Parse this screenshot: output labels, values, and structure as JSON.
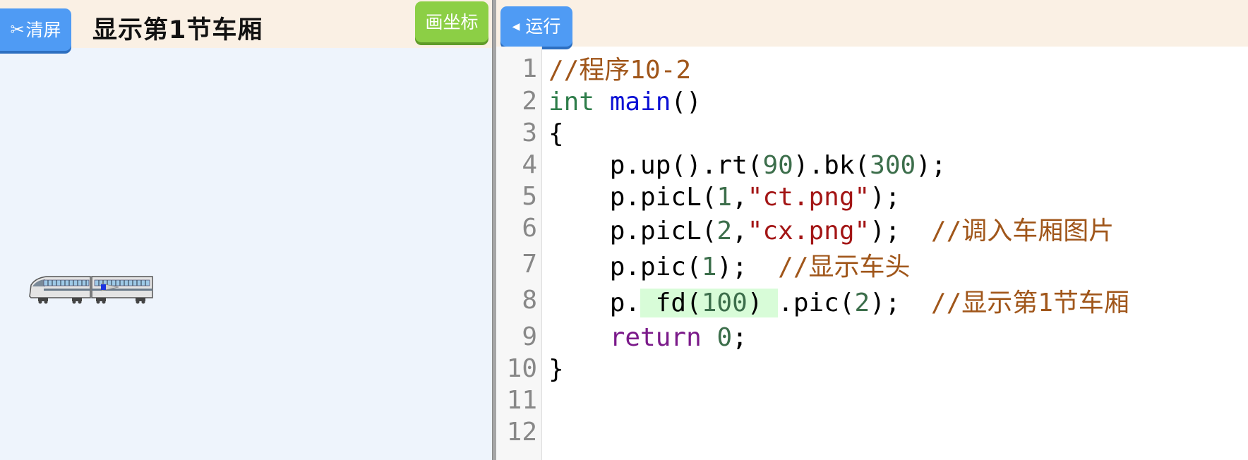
{
  "left": {
    "clear_label": "清屏",
    "title": "显示第1节车厢",
    "grid_label": "画坐标"
  },
  "right": {
    "run_label": "运行"
  },
  "icons": {
    "clear": "scissors-icon",
    "run": "triangle-left-icon"
  },
  "colors": {
    "blue_button": "#4f9bf4",
    "green_button": "#8ccf45",
    "toolbar_bg": "#faf0e4",
    "canvas_bg": "#eef4fc",
    "comment": "#a0561a",
    "keyword": "#2e7d4a",
    "function": "#0b10d4",
    "number": "#3c6e4b",
    "string": "#a31515",
    "return": "#7b1a8a",
    "highlight": "#d8fcd8"
  },
  "code": {
    "line_numbers": [
      "1",
      "2",
      "3",
      "4",
      "5",
      "6",
      "7",
      "8",
      "9",
      "10",
      "11",
      "12"
    ],
    "l1": {
      "comment": "//程序10-2"
    },
    "l2": {
      "kw": "int",
      "fn": "main",
      "rest": "()"
    },
    "l3": {
      "text": "{"
    },
    "l4": {
      "a": "    p.up().rt(",
      "n1": "90",
      "b": ").bk(",
      "n2": "300",
      "c": ");"
    },
    "l5": {
      "a": "    p.picL(",
      "n": "1",
      "b": ",",
      "s": "\"ct.png\"",
      "c": ");"
    },
    "l6": {
      "a": "    p.picL(",
      "n": "2",
      "b": ",",
      "s": "\"cx.png\"",
      "c": ");  ",
      "comment": "//调入车厢图片"
    },
    "l7": {
      "a": "    p.pic(",
      "n": "1",
      "c": ");  ",
      "comment": "//显示车头"
    },
    "l8": {
      "a": "    p.",
      "h1": " fd(",
      "hn": "100",
      "h2": ") ",
      "b": ".pic(",
      "n": "2",
      "c": ");  ",
      "comment": "//显示第1节车厢"
    },
    "l9": {
      "indent": "    ",
      "ret": "return",
      "sp": " ",
      "n": "0",
      "c": ";"
    },
    "l10": {
      "text": "}"
    }
  }
}
